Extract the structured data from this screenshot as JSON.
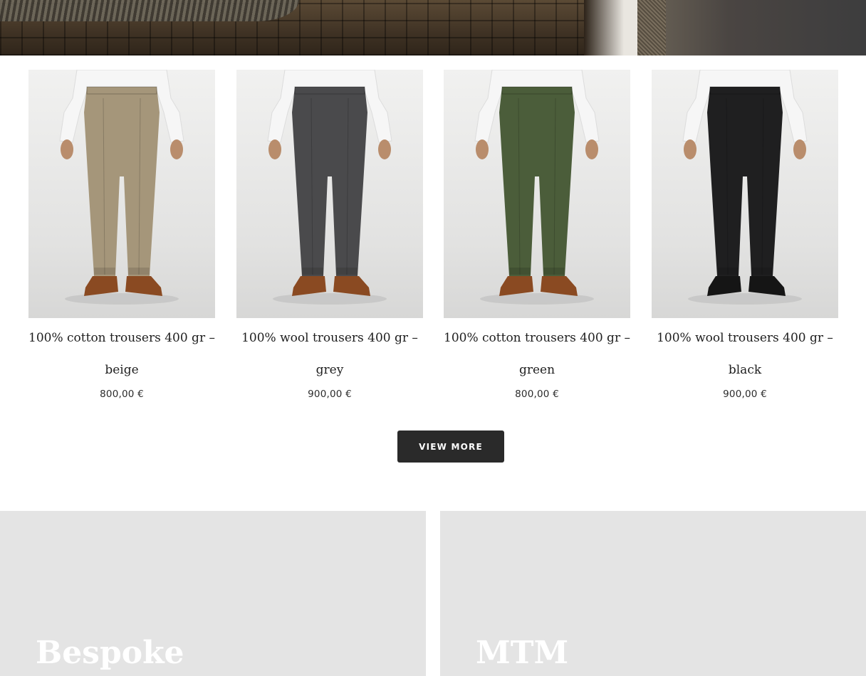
{
  "products": [
    {
      "title": "100% cotton trousers 400 gr – beige",
      "title_line1": "100% cotton trousers 400 gr –",
      "title_line2": "beige",
      "price": "800,00 €",
      "color": "#a5967a"
    },
    {
      "title": "100% wool trousers 400 gr – grey",
      "title_line1": "100% wool trousers 400 gr –",
      "title_line2": "grey",
      "price": "900,00 €",
      "color": "#4a4a4c"
    },
    {
      "title": "100% cotton trousers 400 gr – green",
      "title_line1": "100% cotton trousers 400 gr –",
      "title_line2": "green",
      "price": "800,00 €",
      "color": "#4b5d3a"
    },
    {
      "title": "100% wool trousers 400 gr – black",
      "title_line1": "100% wool trousers 400 gr –",
      "title_line2": "black",
      "price": "900,00 €",
      "color": "#1f1f20"
    }
  ],
  "view_more": {
    "label": "VIEW MORE"
  },
  "categories": [
    {
      "title": "Bespoke"
    },
    {
      "title": "MTM"
    }
  ],
  "colors": {
    "button_bg": "#2a2a2a",
    "card_bg": "#e4e4e4",
    "shoe_brown": "#8a4a22"
  }
}
